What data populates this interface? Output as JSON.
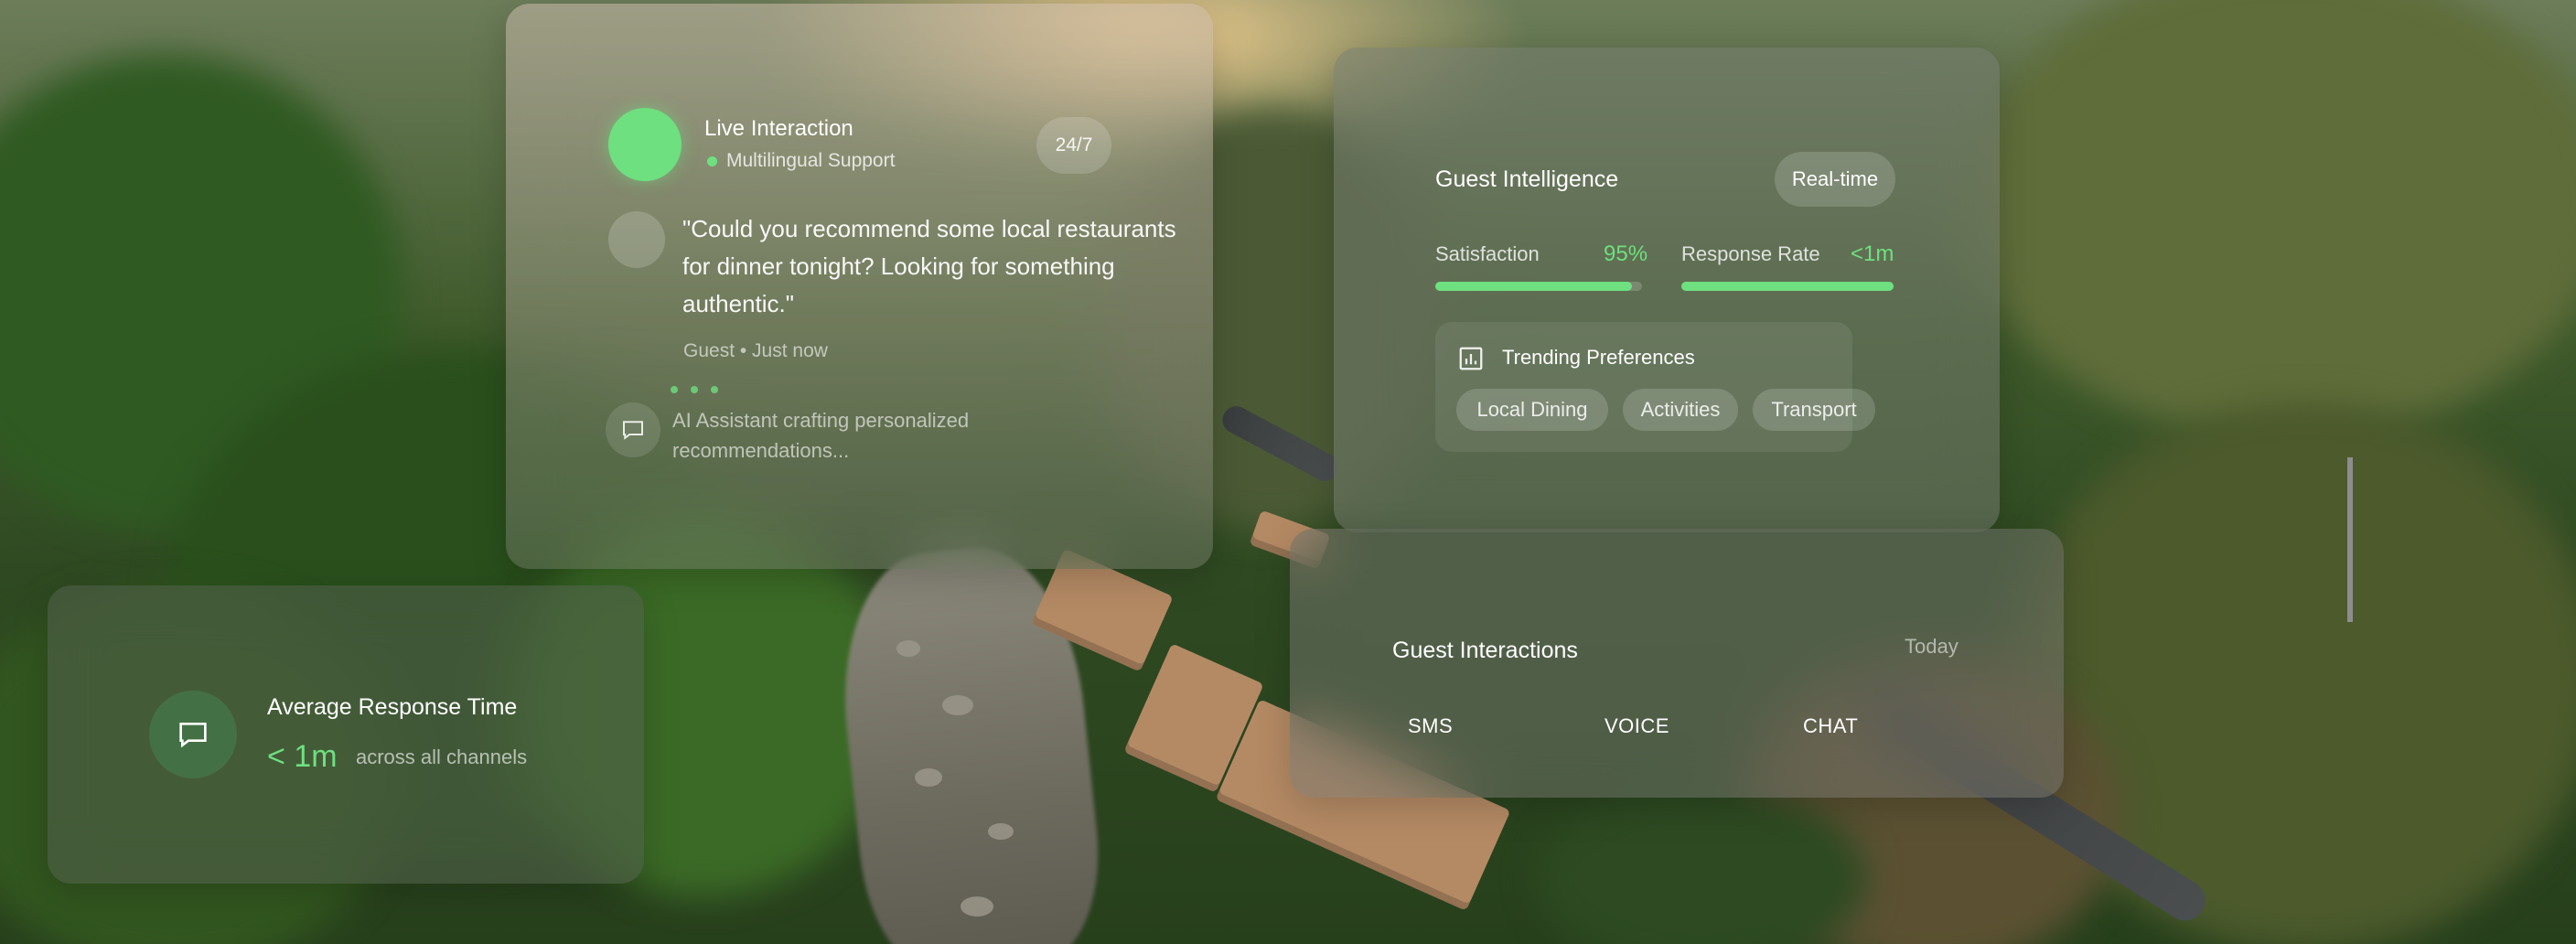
{
  "live": {
    "title": "Live Interaction",
    "subtitle": "Multilingual Support",
    "badge": "24/7",
    "quote": "\"Could you recommend some local restaurants for dinner tonight? Looking for something authentic.\"",
    "meta": "Guest • Just now",
    "assistant_text": "AI Assistant crafting personalized recommendations..."
  },
  "intel": {
    "title": "Guest Intelligence",
    "badge": "Real-time",
    "metrics": [
      {
        "label": "Satisfaction",
        "value": "95%",
        "fill": 0.95
      },
      {
        "label": "Response Rate",
        "value": "<1m",
        "fill": 1.0
      }
    ],
    "trending_title": "Trending Preferences",
    "chips": [
      "Local Dining",
      "Activities",
      "Transport"
    ]
  },
  "guest_interactions": {
    "title": "Guest Interactions",
    "period": "Today",
    "channels": [
      "SMS",
      "VOICE",
      "CHAT"
    ]
  },
  "response": {
    "title": "Average Response Time",
    "value": "< 1m",
    "note": "across all channels"
  },
  "colors": {
    "accent": "#6ee07f"
  }
}
